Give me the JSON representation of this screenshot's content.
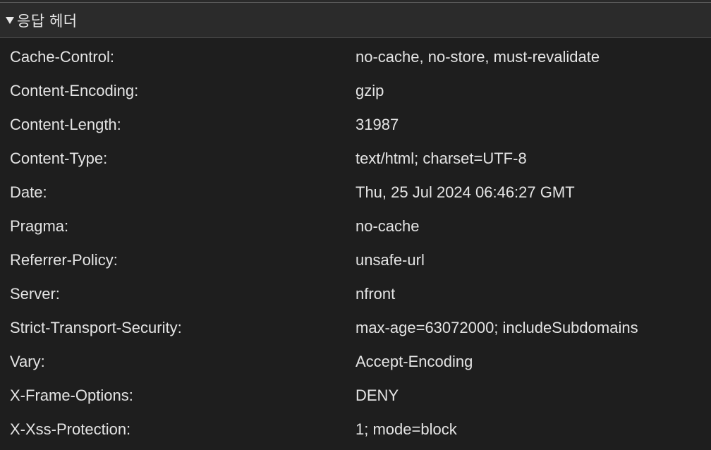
{
  "section": {
    "title": "응답 헤더",
    "collapsed": false
  },
  "headers": [
    {
      "key": "Cache-Control:",
      "value": "no-cache, no-store, must-revalidate"
    },
    {
      "key": "Content-Encoding:",
      "value": "gzip"
    },
    {
      "key": "Content-Length:",
      "value": "31987"
    },
    {
      "key": "Content-Type:",
      "value": "text/html; charset=UTF-8"
    },
    {
      "key": "Date:",
      "value": "Thu, 25 Jul 2024 06:46:27 GMT"
    },
    {
      "key": "Pragma:",
      "value": "no-cache"
    },
    {
      "key": "Referrer-Policy:",
      "value": "unsafe-url"
    },
    {
      "key": "Server:",
      "value": "nfront"
    },
    {
      "key": "Strict-Transport-Security:",
      "value": "max-age=63072000; includeSubdomains"
    },
    {
      "key": "Vary:",
      "value": "Accept-Encoding"
    },
    {
      "key": "X-Frame-Options:",
      "value": "DENY"
    },
    {
      "key": "X-Xss-Protection:",
      "value": "1; mode=block"
    }
  ],
  "colors": {
    "background": "#1e1e1e",
    "header_background": "#2b2b2b",
    "text": "#e4e4e4",
    "divider": "#4a4a4a"
  }
}
